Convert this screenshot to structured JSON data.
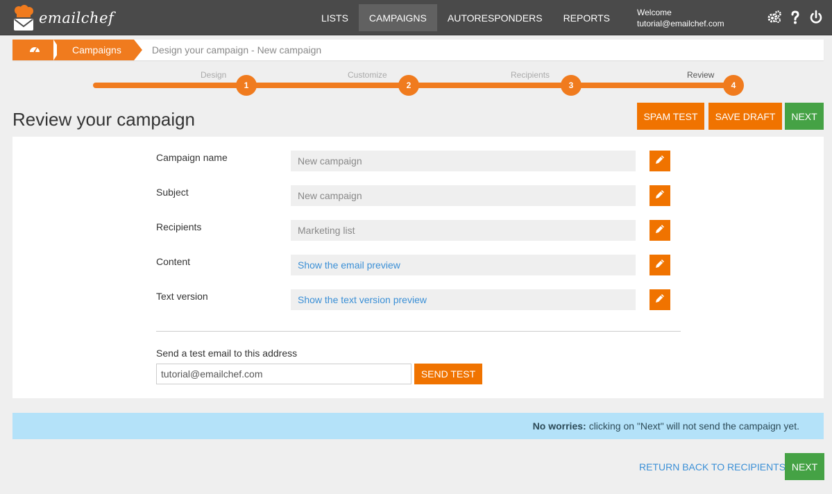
{
  "brand": {
    "name": "emailchef",
    "accent": "#f07300",
    "success": "#45a245"
  },
  "nav": {
    "items": [
      {
        "label": "LISTS",
        "active": false
      },
      {
        "label": "CAMPAIGNS",
        "active": true
      },
      {
        "label": "AUTORESPONDERS",
        "active": false
      },
      {
        "label": "REPORTS",
        "active": false
      }
    ],
    "welcome_label": "Welcome",
    "user_email": "tutorial@emailchef.com",
    "icons": [
      "settings-gears-icon",
      "help-icon",
      "power-icon"
    ]
  },
  "breadcrumb": {
    "home_icon": "dashboard-icon",
    "section": "Campaigns",
    "current": "Design your campaign - New campaign"
  },
  "stepper": {
    "steps": [
      {
        "number": "1",
        "label": "Design"
      },
      {
        "number": "2",
        "label": "Customize"
      },
      {
        "number": "3",
        "label": "Recipients"
      },
      {
        "number": "4",
        "label": "Review"
      }
    ],
    "current_step": 4
  },
  "page": {
    "title": "Review your campaign",
    "spam_test": "SPAM TEST",
    "save_draft": "SAVE DRAFT",
    "next": "NEXT"
  },
  "review": {
    "rows": [
      {
        "label": "Campaign name",
        "value": "New campaign"
      },
      {
        "label": "Subject",
        "value": "New campaign"
      },
      {
        "label": "Recipients",
        "value": "Marketing list"
      },
      {
        "label": "Content",
        "value": "Show the email preview"
      },
      {
        "label": "Text version",
        "value": "Show the text version preview"
      }
    ],
    "edit_icon": "pencil-icon"
  },
  "test_email": {
    "label": "Send a test email to this address",
    "value": "tutorial@emailchef.com",
    "button": "SEND TEST"
  },
  "info": {
    "bold": "No worries:",
    "text": "clicking on \"Next\" will not send the campaign yet."
  },
  "footer": {
    "return_link": "RETURN BACK TO RECIPIENTS",
    "next": "NEXT"
  }
}
